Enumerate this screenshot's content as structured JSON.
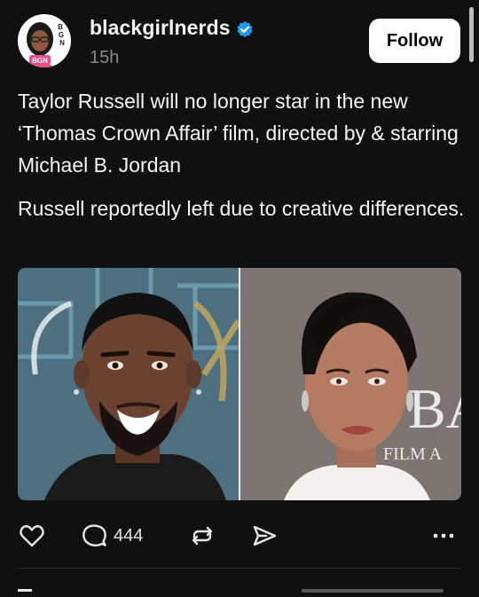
{
  "post": {
    "author": {
      "username": "blackgirlnerds",
      "avatar_badge": "BGN",
      "verified_icon": "verified-badge-icon",
      "verified_color": "#1d9bf0"
    },
    "timestamp": "15h",
    "follow_label": "Follow",
    "paragraphs": [
      "Taylor Russell will no longer star in the new ‘Thomas Crown Affair’ film, directed by & starring Michael B. Jordan",
      "Russell reportedly left due to creative differences."
    ],
    "media": {
      "left_image": "portrait-man-icon",
      "right_image": "portrait-woman-icon",
      "backdrop_text_right": [
        "BA",
        "FILM A"
      ]
    },
    "actions": {
      "like_icon": "heart-icon",
      "reply_icon": "comment-icon",
      "reply_count": "444",
      "repost_icon": "repost-icon",
      "share_icon": "send-icon",
      "more_icon": "more-icon"
    }
  }
}
